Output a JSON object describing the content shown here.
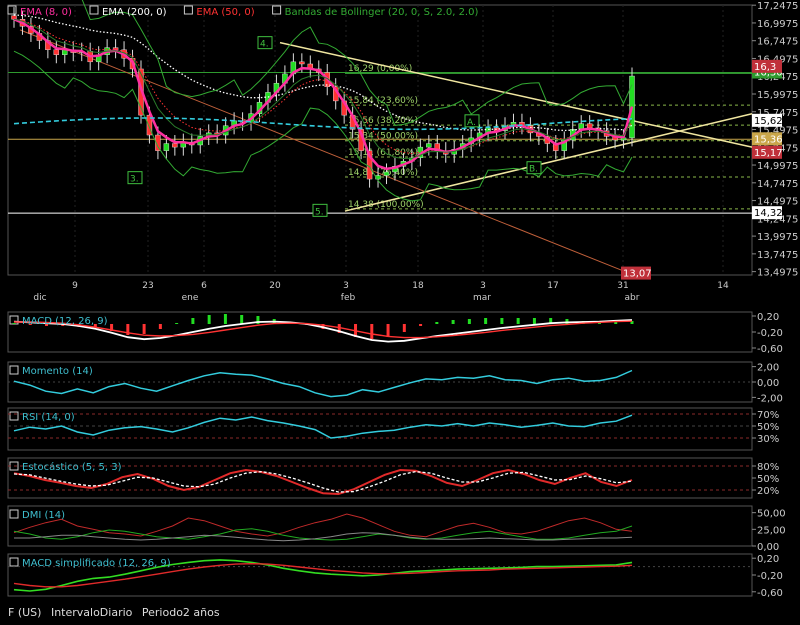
{
  "footer": {
    "symbol": "F (US)",
    "interval": "IntervaloDiario",
    "period": "Periodo2 años"
  },
  "colors": {
    "background": "#000000",
    "candle_up": "#22dd22",
    "candle_down": "#ff3333",
    "ema8": "#ff2fa0",
    "ema200": "#ffffff",
    "ema50": "#ff3333",
    "bollinger": "#33aa33",
    "cyan": "#33ccdd",
    "trend": "#f0e6a0"
  },
  "chart_data": [
    {
      "type": "candlestick",
      "legend": [
        {
          "label": "EMA (8, 0)",
          "color": "#ff2fa0"
        },
        {
          "label": "EMA (200, 0)",
          "color": "#ffffff"
        },
        {
          "label": "EMA (50, 0)",
          "color": "#ff3333"
        },
        {
          "label": "Bandas de Bollinger (20, 0, S, 2.0, 2.0)",
          "color": "#33aa33"
        }
      ],
      "x_ticks": [
        "9",
        "23",
        "6",
        "20",
        "3",
        "18",
        "3",
        "17",
        "31",
        "14"
      ],
      "x_month_labels": [
        "dic",
        "ene",
        "feb",
        "mar",
        "abr"
      ],
      "y_ticks": [
        "17,2475",
        "16,9975",
        "16,7475",
        "16,4975",
        "16,2475",
        "15,9975",
        "15,7475",
        "15,4975",
        "15,2475",
        "14,9975",
        "14,7475",
        "14,4975",
        "14,2475",
        "13,9975",
        "13,7475",
        "13,4975"
      ],
      "ylim": [
        13.45,
        17.25
      ],
      "fib_levels": [
        {
          "label": "16,29  (0,00%)",
          "value": 16.29
        },
        {
          "label": "15,84  (23,60%)",
          "value": 15.84
        },
        {
          "label": "15,56  (38,20%)",
          "value": 15.56
        },
        {
          "label": "15,34  (50,00%)",
          "value": 15.34
        },
        {
          "label": "15,11  (61,80%)",
          "value": 15.11
        },
        {
          "label": "14,83  (76,40%)",
          "value": 14.83
        },
        {
          "label": "14,38  (100,00%)",
          "value": 14.38
        }
      ],
      "price_tags": [
        {
          "label": "16,30",
          "value": 16.3
        },
        {
          "label": "16,3",
          "value": 16.38
        },
        {
          "label": "15,62",
          "value": 15.62
        },
        {
          "label": "15,36",
          "value": 15.36
        },
        {
          "label": "15,17",
          "value": 15.17
        },
        {
          "label": "14,32",
          "value": 14.32
        },
        {
          "label": "13,07",
          "value": 13.47
        }
      ],
      "wave_labels": [
        "4.",
        "3.",
        "5.",
        "A.",
        "B."
      ],
      "closes": [
        17.05,
        16.95,
        16.85,
        16.75,
        16.62,
        16.55,
        16.62,
        16.58,
        16.6,
        16.45,
        16.55,
        16.65,
        16.62,
        16.5,
        16.35,
        15.7,
        15.42,
        15.2,
        15.3,
        15.25,
        15.32,
        15.28,
        15.4,
        15.45,
        15.42,
        15.55,
        15.62,
        15.6,
        15.72,
        15.88,
        16.02,
        16.15,
        16.28,
        16.45,
        16.42,
        16.35,
        16.3,
        16.1,
        15.9,
        15.7,
        15.5,
        15.2,
        14.8,
        14.85,
        14.9,
        14.98,
        15.05,
        15.1,
        15.25,
        15.3,
        15.2,
        15.15,
        15.22,
        15.3,
        15.38,
        15.45,
        15.52,
        15.48,
        15.55,
        15.6,
        15.55,
        15.45,
        15.4,
        15.3,
        15.2,
        15.35,
        15.5,
        15.58,
        15.52,
        15.48,
        15.4,
        15.35,
        15.38,
        16.25
      ]
    },
    {
      "type": "line",
      "name": "MACD (12, 26, 9)",
      "y_ticks": [
        "0,20",
        "-0,20",
        "-0,60"
      ],
      "ylim": [
        -0.7,
        0.3
      ],
      "macd": [
        0.06,
        0.04,
        0.02,
        0.0,
        -0.05,
        -0.12,
        -0.22,
        -0.33,
        -0.38,
        -0.35,
        -0.28,
        -0.2,
        -0.12,
        -0.05,
        0.0,
        0.05,
        0.06,
        0.04,
        0.0,
        -0.08,
        -0.18,
        -0.3,
        -0.4,
        -0.44,
        -0.42,
        -0.36,
        -0.3,
        -0.25,
        -0.2,
        -0.15,
        -0.1,
        -0.06,
        -0.02,
        0.02,
        0.04,
        0.05,
        0.06,
        0.08,
        0.1
      ],
      "signal": [
        0.05,
        0.05,
        0.04,
        0.02,
        -0.02,
        -0.08,
        -0.15,
        -0.22,
        -0.28,
        -0.3,
        -0.29,
        -0.26,
        -0.21,
        -0.15,
        -0.09,
        -0.03,
        0.01,
        0.02,
        0.01,
        -0.03,
        -0.09,
        -0.17,
        -0.25,
        -0.31,
        -0.34,
        -0.34,
        -0.32,
        -0.29,
        -0.25,
        -0.21,
        -0.16,
        -0.12,
        -0.08,
        -0.04,
        -0.01,
        0.02,
        0.04,
        0.06,
        0.07
      ]
    },
    {
      "type": "line",
      "name": "Momento (14)",
      "y_ticks": [
        "2,00",
        "0,00",
        "-2,00"
      ],
      "ylim": [
        -2.6,
        2.6
      ],
      "values": [
        0.1,
        -0.4,
        -1.2,
        -1.5,
        -0.9,
        -1.4,
        -0.6,
        -0.2,
        -0.8,
        -1.2,
        -0.5,
        0.2,
        0.8,
        1.2,
        1.0,
        0.9,
        0.4,
        -0.2,
        -0.6,
        -1.4,
        -1.9,
        -1.7,
        -1.0,
        -1.3,
        -0.7,
        -0.1,
        0.4,
        0.3,
        0.6,
        0.5,
        0.8,
        0.3,
        0.2,
        -0.2,
        0.3,
        0.5,
        0.1,
        0.2,
        0.6,
        1.5
      ]
    },
    {
      "type": "line",
      "name": "RSI (14, 0)",
      "y_ticks": [
        "70%",
        "50%",
        "30%"
      ],
      "ylim": [
        10,
        80
      ],
      "values": [
        42,
        48,
        45,
        50,
        40,
        35,
        43,
        47,
        49,
        45,
        40,
        47,
        56,
        63,
        60,
        65,
        59,
        55,
        50,
        44,
        30,
        33,
        38,
        41,
        43,
        48,
        52,
        50,
        54,
        50,
        55,
        52,
        48,
        51,
        55,
        50,
        49,
        55,
        58,
        68
      ]
    },
    {
      "type": "line",
      "name": "Estocástico (5, 5, 3)",
      "y_ticks": [
        "80%",
        "50%",
        "20%"
      ],
      "ylim": [
        0,
        100
      ],
      "k": [
        62,
        55,
        45,
        38,
        30,
        25,
        35,
        52,
        60,
        48,
        30,
        20,
        28,
        45,
        62,
        70,
        65,
        55,
        40,
        25,
        12,
        10,
        22,
        40,
        58,
        70,
        68,
        55,
        38,
        30,
        45,
        62,
        70,
        60,
        45,
        35,
        50,
        62,
        40,
        30,
        45
      ],
      "d": [
        60,
        58,
        50,
        42,
        35,
        30,
        32,
        42,
        52,
        50,
        40,
        30,
        28,
        35,
        50,
        62,
        66,
        60,
        50,
        38,
        25,
        15,
        16,
        28,
        42,
        58,
        66,
        62,
        50,
        40,
        40,
        50,
        62,
        64,
        55,
        45,
        46,
        55,
        48,
        38,
        42
      ]
    },
    {
      "type": "line",
      "name": "DMI (14)",
      "y_ticks": [
        "50,00",
        "25,00",
        "0,00"
      ],
      "ylim": [
        0,
        60
      ],
      "plus_di": [
        20,
        28,
        35,
        40,
        30,
        25,
        20,
        18,
        15,
        22,
        30,
        42,
        38,
        30,
        22,
        18,
        15,
        20,
        28,
        35,
        40,
        48,
        42,
        32,
        22,
        16,
        14,
        22,
        30,
        34,
        28,
        20,
        18,
        22,
        30,
        38,
        42,
        35,
        25,
        22
      ],
      "minus_di": [
        22,
        18,
        12,
        10,
        14,
        20,
        24,
        22,
        18,
        14,
        12,
        10,
        14,
        18,
        24,
        26,
        22,
        16,
        12,
        10,
        9,
        10,
        14,
        18,
        16,
        12,
        10,
        12,
        16,
        20,
        22,
        18,
        14,
        10,
        10,
        12,
        16,
        20,
        22,
        30
      ],
      "adx": [
        12,
        12,
        14,
        16,
        16,
        14,
        12,
        10,
        9,
        10,
        12,
        14,
        16,
        15,
        13,
        11,
        9,
        8,
        9,
        11,
        14,
        18,
        20,
        19,
        16,
        13,
        11,
        10,
        10,
        11,
        12,
        11,
        10,
        9,
        9,
        10,
        11,
        12,
        12,
        13
      ]
    },
    {
      "type": "line",
      "name": "MACD simplificado (12, 26, 9)",
      "y_ticks": [
        "0,20",
        "-0,20",
        "-0,60"
      ],
      "ylim": [
        -0.7,
        0.3
      ],
      "macd": [
        -0.55,
        -0.58,
        -0.54,
        -0.45,
        -0.35,
        -0.28,
        -0.25,
        -0.18,
        -0.1,
        -0.02,
        0.05,
        0.1,
        0.14,
        0.16,
        0.14,
        0.1,
        0.04,
        -0.04,
        -0.1,
        -0.15,
        -0.18,
        -0.2,
        -0.22,
        -0.2,
        -0.16,
        -0.12,
        -0.1,
        -0.08,
        -0.06,
        -0.05,
        -0.04,
        -0.03,
        -0.02,
        0.0,
        0.0,
        0.01,
        0.02,
        0.03,
        0.04,
        0.1
      ],
      "signal": [
        -0.4,
        -0.45,
        -0.48,
        -0.48,
        -0.45,
        -0.4,
        -0.35,
        -0.3,
        -0.24,
        -0.18,
        -0.12,
        -0.06,
        -0.01,
        0.03,
        0.06,
        0.07,
        0.06,
        0.03,
        -0.01,
        -0.05,
        -0.09,
        -0.12,
        -0.15,
        -0.17,
        -0.17,
        -0.16,
        -0.14,
        -0.12,
        -0.1,
        -0.09,
        -0.08,
        -0.06,
        -0.05,
        -0.04,
        -0.03,
        -0.02,
        -0.01,
        0.0,
        0.01,
        0.03
      ]
    }
  ]
}
